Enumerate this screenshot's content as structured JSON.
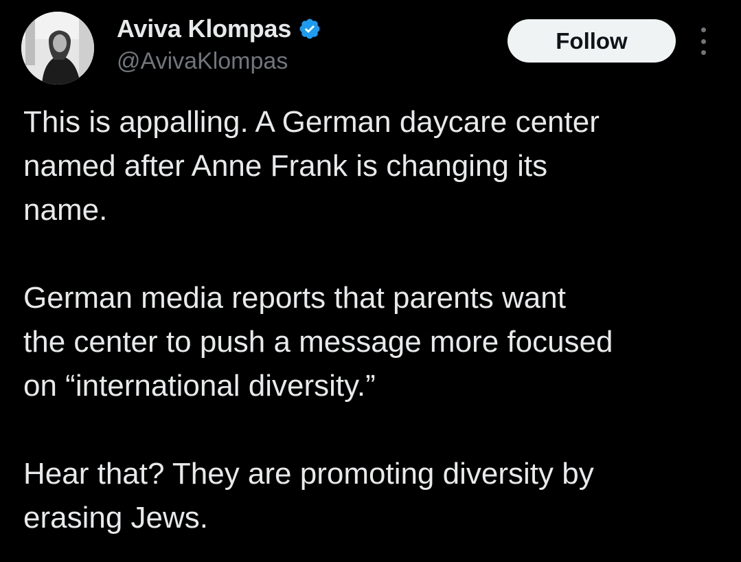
{
  "author": {
    "display_name": "Aviva Klompas",
    "handle": "@AvivaKlompas",
    "verified_icon": "verified-badge-icon",
    "verified_color": "#1d9bf0"
  },
  "actions": {
    "follow_label": "Follow",
    "more_icon": "more-vertical-icon"
  },
  "tweet": {
    "paragraphs": [
      "This is appalling. A German daycare center\nnamed after Anne Frank is changing its\nname.",
      "German media reports that parents want\nthe center to push a message more focused\non “international diversity.”",
      "Hear that? They are promoting diversity by\nerasing Jews."
    ]
  },
  "colors": {
    "background": "#000000",
    "text_primary": "#e7e9ea",
    "text_secondary": "#71767b",
    "button_bg": "#eff3f4",
    "button_text": "#0f1419"
  }
}
